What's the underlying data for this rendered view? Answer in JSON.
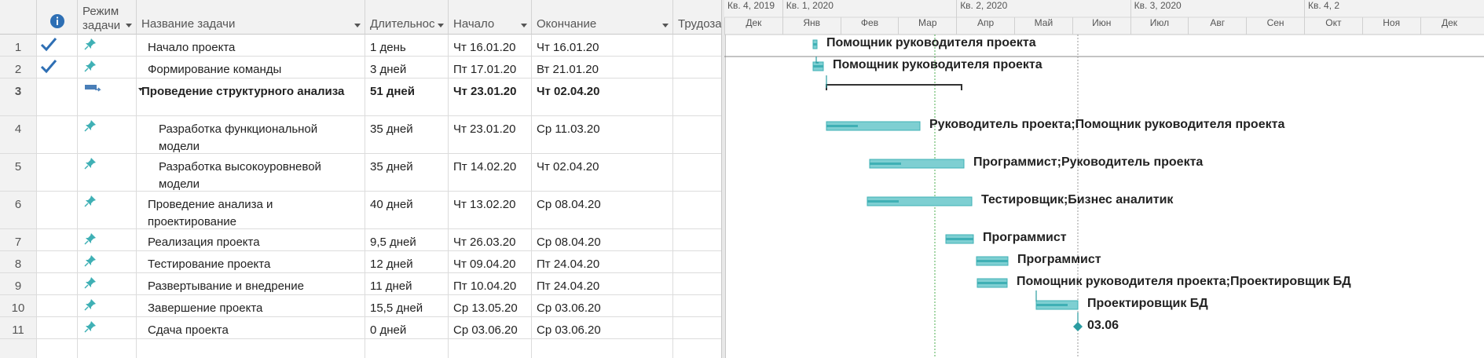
{
  "columns": {
    "indicators_icon": "info-icon",
    "mode": "Режим задачи",
    "name": "Название задачи",
    "duration": "Длительнос",
    "start": "Начало",
    "finish": "Окончание",
    "work": "Трудозат"
  },
  "rows": [
    {
      "id": "1",
      "done": true,
      "name": "Начало проекта",
      "duration": "1 день",
      "start": "Чт 16.01.20",
      "finish": "Чт 16.01.20",
      "indent": 1,
      "bold": false,
      "summary": false
    },
    {
      "id": "2",
      "done": true,
      "name": "Формирование команды",
      "duration": "3 дней",
      "start": "Пт 17.01.20",
      "finish": "Вт 21.01.20",
      "indent": 1,
      "bold": false,
      "summary": false
    },
    {
      "id": "3",
      "done": false,
      "name": "Проведение структурного анализа",
      "duration": "51 дней",
      "start": "Чт 23.01.20",
      "finish": "Чт 02.04.20",
      "indent": 0,
      "bold": true,
      "summary": true
    },
    {
      "id": "4",
      "done": false,
      "name": "Разработка функциональной модели",
      "duration": "35 дней",
      "start": "Чт 23.01.20",
      "finish": "Ср 11.03.20",
      "indent": 2,
      "bold": false,
      "summary": false
    },
    {
      "id": "5",
      "done": false,
      "name": "Разработка высокоуровневой модели",
      "duration": "35 дней",
      "start": "Пт 14.02.20",
      "finish": "Чт 02.04.20",
      "indent": 2,
      "bold": false,
      "summary": false
    },
    {
      "id": "6",
      "done": false,
      "name": "Проведение анализа и проектирование",
      "duration": "40 дней",
      "start": "Чт 13.02.20",
      "finish": "Ср 08.04.20",
      "indent": 1,
      "bold": false,
      "summary": false
    },
    {
      "id": "7",
      "done": false,
      "name": "Реализация проекта",
      "duration": "9,5 дней",
      "start": "Чт 26.03.20",
      "finish": "Ср 08.04.20",
      "indent": 1,
      "bold": false,
      "summary": false
    },
    {
      "id": "8",
      "done": false,
      "name": "Тестирование проекта",
      "duration": "12 дней",
      "start": "Чт 09.04.20",
      "finish": "Пт 24.04.20",
      "indent": 1,
      "bold": false,
      "summary": false
    },
    {
      "id": "9",
      "done": false,
      "name": "Развертывание и внедрение",
      "duration": "11 дней",
      "start": "Пт 10.04.20",
      "finish": "Пт 24.04.20",
      "indent": 1,
      "bold": false,
      "summary": false
    },
    {
      "id": "10",
      "done": false,
      "name": "Завершение проекта",
      "duration": "15,5 дней",
      "start": "Ср 13.05.20",
      "finish": "Ср 03.06.20",
      "indent": 1,
      "bold": false,
      "summary": false
    },
    {
      "id": "11",
      "done": false,
      "name": "Сдача проекта",
      "duration": "0 дней",
      "start": "Ср 03.06.20",
      "finish": "Ср 03.06.20",
      "indent": 1,
      "bold": false,
      "summary": false
    }
  ],
  "timescale": {
    "quarters": [
      "Кв. 4, 2019",
      "Кв. 1, 2020",
      "Кв. 2, 2020",
      "Кв. 3, 2020",
      "Кв. 4, 2"
    ],
    "months": [
      "Дек",
      "Янв",
      "Фев",
      "Мар",
      "Апр",
      "Май",
      "Июн",
      "Июл",
      "Авг",
      "Сен",
      "Окт",
      "Ноя",
      "Дек"
    ]
  },
  "gantt_labels": [
    "Помощник руководителя проекта",
    "Помощник руководителя проекта",
    "",
    "Руководитель проекта;Помощник руководителя проекта",
    "Программист;Руководитель проекта",
    "Тестировщик;Бизнес аналитик",
    "Программист",
    "Программист",
    "Помощник руководителя проекта;Проектировщик БД",
    "Проектировщик БД",
    "03.06"
  ],
  "colors": {
    "bar": "#7ecfd2",
    "bar_edge": "#3fb0b5",
    "check": "#2e6fb4",
    "pin": "#3fb0b5",
    "today": "#4caf50"
  }
}
